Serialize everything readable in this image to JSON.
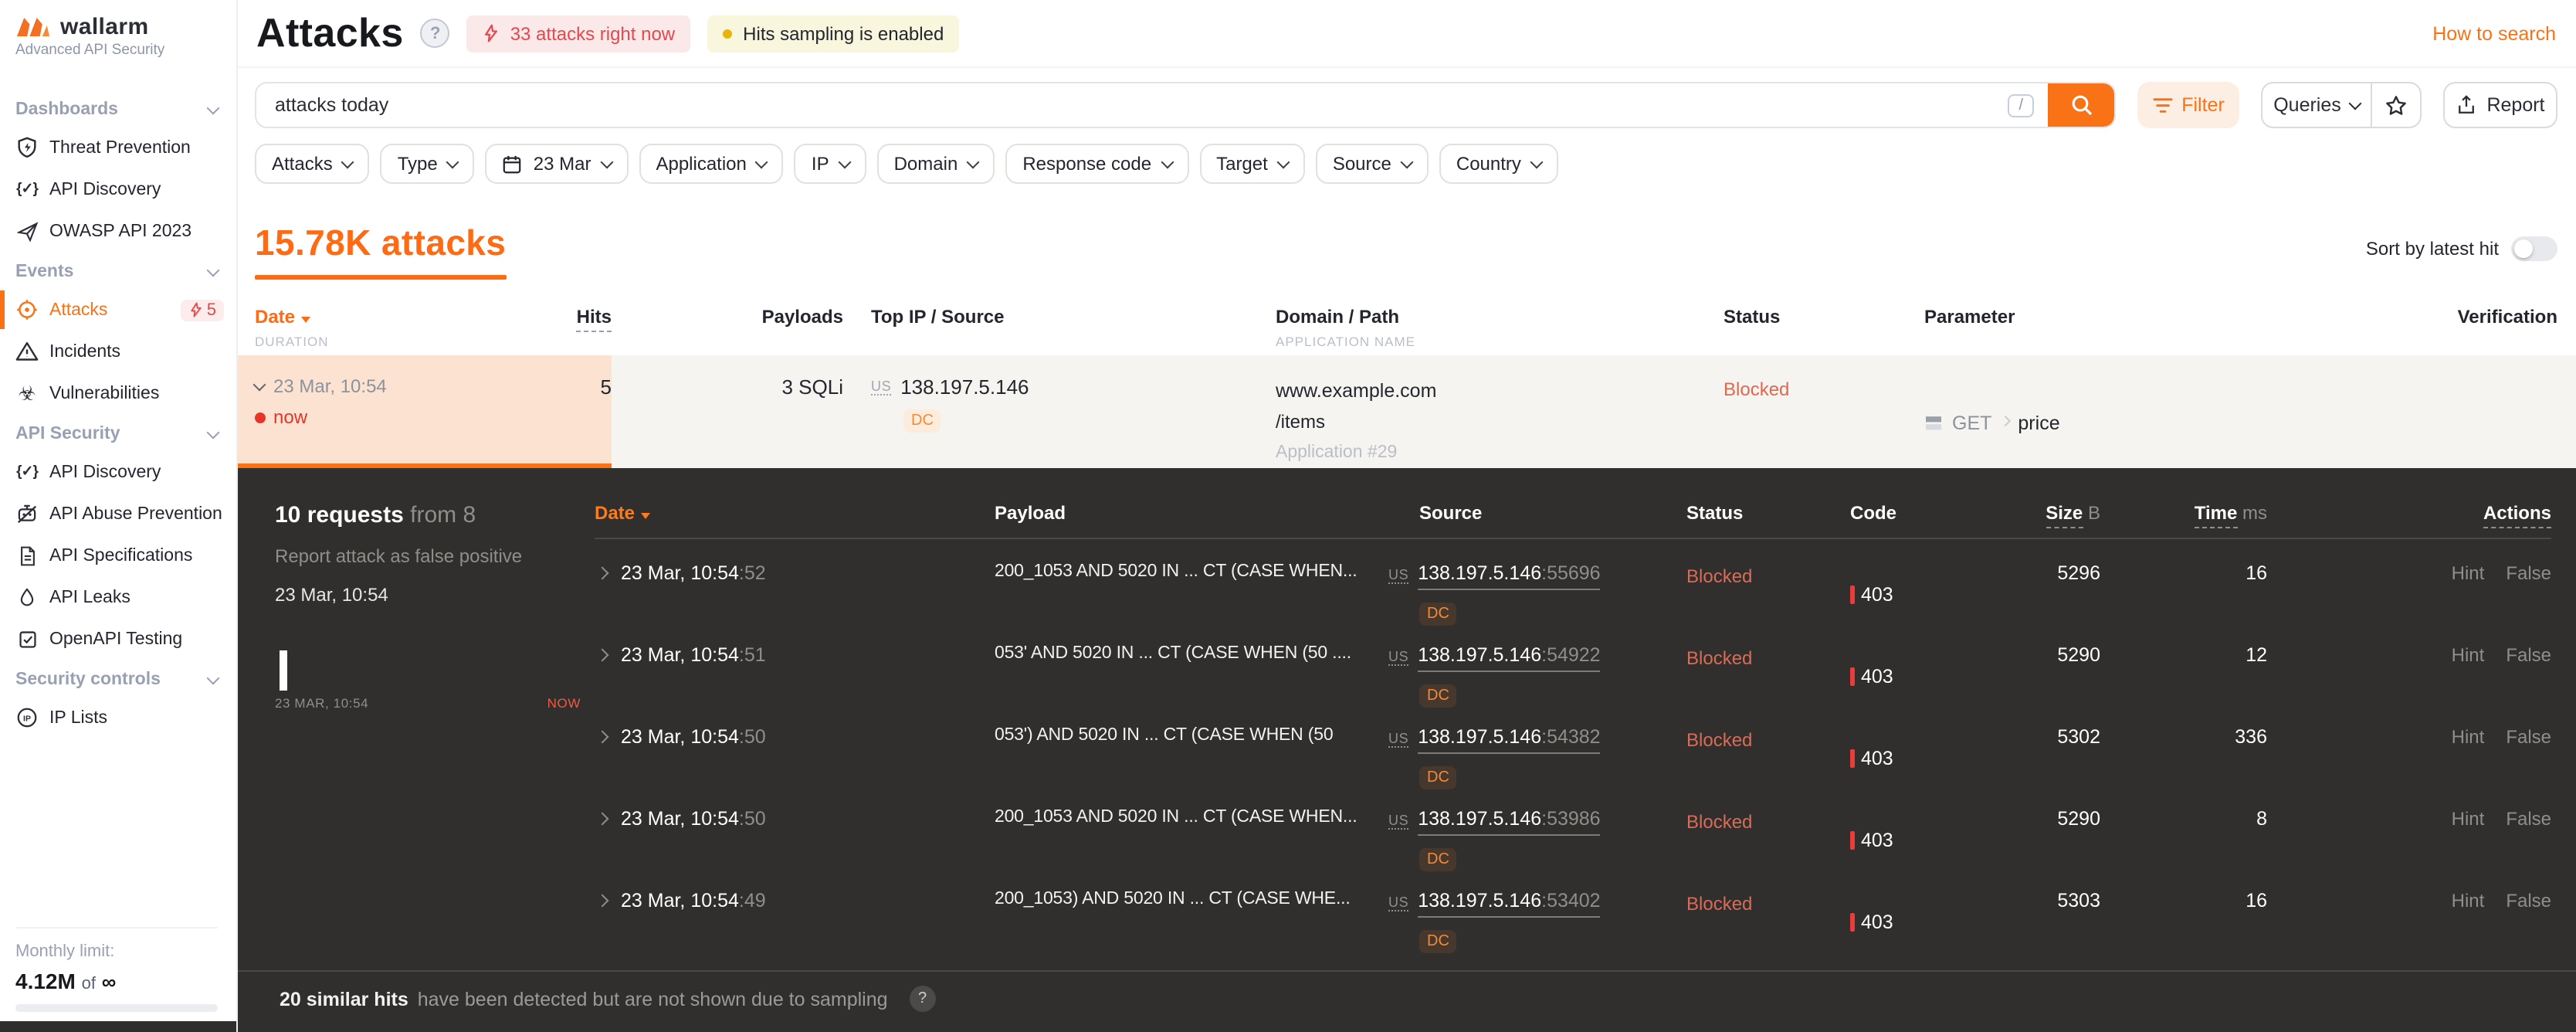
{
  "brand": {
    "name": "wallarm",
    "tagline": "Advanced API Security"
  },
  "sidebar": {
    "sections": [
      {
        "label": "Dashboards",
        "items": [
          {
            "label": "Threat Prevention"
          },
          {
            "label": "API Discovery"
          },
          {
            "label": "OWASP API 2023"
          }
        ]
      },
      {
        "label": "Events",
        "items": [
          {
            "label": "Attacks",
            "badge": "5"
          },
          {
            "label": "Incidents"
          },
          {
            "label": "Vulnerabilities"
          }
        ]
      },
      {
        "label": "API Security",
        "items": [
          {
            "label": "API Discovery"
          },
          {
            "label": "API Abuse Prevention"
          },
          {
            "label": "API Specifications"
          },
          {
            "label": "API Leaks"
          },
          {
            "label": "OpenAPI Testing"
          }
        ]
      },
      {
        "label": "Security controls",
        "items": [
          {
            "label": "IP Lists"
          }
        ]
      }
    ],
    "monthly": {
      "label": "Monthly limit:",
      "value": "4.12M",
      "of": "of",
      "total": "∞"
    }
  },
  "topbar": {
    "title": "Attacks",
    "help": "?",
    "attacks_badge": "33 attacks right now",
    "sampling_badge": "Hits sampling is enabled",
    "link": "How to search"
  },
  "search": {
    "value": "attacks today",
    "shortcut": "/",
    "filter": "Filter",
    "queries": "Queries",
    "report": "Report"
  },
  "filters": [
    "Attacks",
    "Type",
    "23 Mar",
    "Application",
    "IP",
    "Domain",
    "Response code",
    "Target",
    "Source",
    "Country"
  ],
  "results": {
    "count": "15.78K attacks",
    "sort": "Sort by latest hit"
  },
  "colors": {
    "accent": "#f97316",
    "heading": "#ff6a13",
    "blocked": "#e0684f",
    "code_error": "#ec3b3b",
    "panel_dark": "#302f2d"
  },
  "attack_table": {
    "headers": {
      "date": "Date",
      "duration": "DURATION",
      "hits": "Hits",
      "payloads": "Payloads",
      "source": "Top IP / Source",
      "domain": "Domain / Path",
      "application": "APPLICATION NAME",
      "status": "Status",
      "parameter": "Parameter",
      "verification": "Verification"
    },
    "row": {
      "date": "23 Mar, 10:54",
      "live": "now",
      "hits": "5",
      "payloads": "3 SQLi",
      "country": "US",
      "ip": "138.197.5.146",
      "datacenter": "DC",
      "domain": "www.example.com",
      "path": "/items",
      "application": "Application #29",
      "status": "Blocked",
      "method": "GET",
      "parameter": "price"
    }
  },
  "detail": {
    "title": "10 requests",
    "from": "from 8",
    "report_link": "Report attack as false positive",
    "started": "23 Mar, 10:54",
    "timeline": {
      "start": "23 MAR, 10:54",
      "end": "NOW"
    },
    "headers": {
      "date": "Date",
      "payload": "Payload",
      "source": "Source",
      "status": "Status",
      "code": "Code",
      "size": "Size",
      "size_unit": "B",
      "time": "Time",
      "time_unit": "ms",
      "actions": "Actions"
    },
    "rows": [
      {
        "date": "23 Mar, 10:54",
        "seconds": ":52",
        "payload": "200_1053 AND 5020 IN ... CT (CASE WHEN...",
        "country": "US",
        "ip": "138.197.5.146",
        "port": ":55696",
        "datacenter": "DC",
        "status": "Blocked",
        "code": "403",
        "size": "5296",
        "time": "16",
        "hint": "Hint",
        "false_label": "False"
      },
      {
        "date": "23 Mar, 10:54",
        "seconds": ":51",
        "payload": "053' AND 5020 IN ... CT (CASE WHEN (50 ....",
        "country": "US",
        "ip": "138.197.5.146",
        "port": ":54922",
        "datacenter": "DC",
        "status": "Blocked",
        "code": "403",
        "size": "5290",
        "time": "12",
        "hint": "Hint",
        "false_label": "False"
      },
      {
        "date": "23 Mar, 10:54",
        "seconds": ":50",
        "payload": "053') AND 5020 IN ... CT (CASE WHEN (50",
        "country": "US",
        "ip": "138.197.5.146",
        "port": ":54382",
        "datacenter": "DC",
        "status": "Blocked",
        "code": "403",
        "size": "5302",
        "time": "336",
        "hint": "Hint",
        "false_label": "False"
      },
      {
        "date": "23 Mar, 10:54",
        "seconds": ":50",
        "payload": "200_1053 AND 5020 IN ... CT (CASE WHEN...",
        "country": "US",
        "ip": "138.197.5.146",
        "port": ":53986",
        "datacenter": "DC",
        "status": "Blocked",
        "code": "403",
        "size": "5290",
        "time": "8",
        "hint": "Hint",
        "false_label": "False"
      },
      {
        "date": "23 Mar, 10:54",
        "seconds": ":49",
        "payload": "200_1053) AND 5020 IN ... CT (CASE WHE...",
        "country": "US",
        "ip": "138.197.5.146",
        "port": ":53402",
        "datacenter": "DC",
        "status": "Blocked",
        "code": "403",
        "size": "5303",
        "time": "16",
        "hint": "Hint",
        "false_label": "False"
      }
    ],
    "footer": {
      "highlight": "20 similar hits",
      "text": "have been detected but are not shown due to sampling",
      "help": "?"
    }
  }
}
